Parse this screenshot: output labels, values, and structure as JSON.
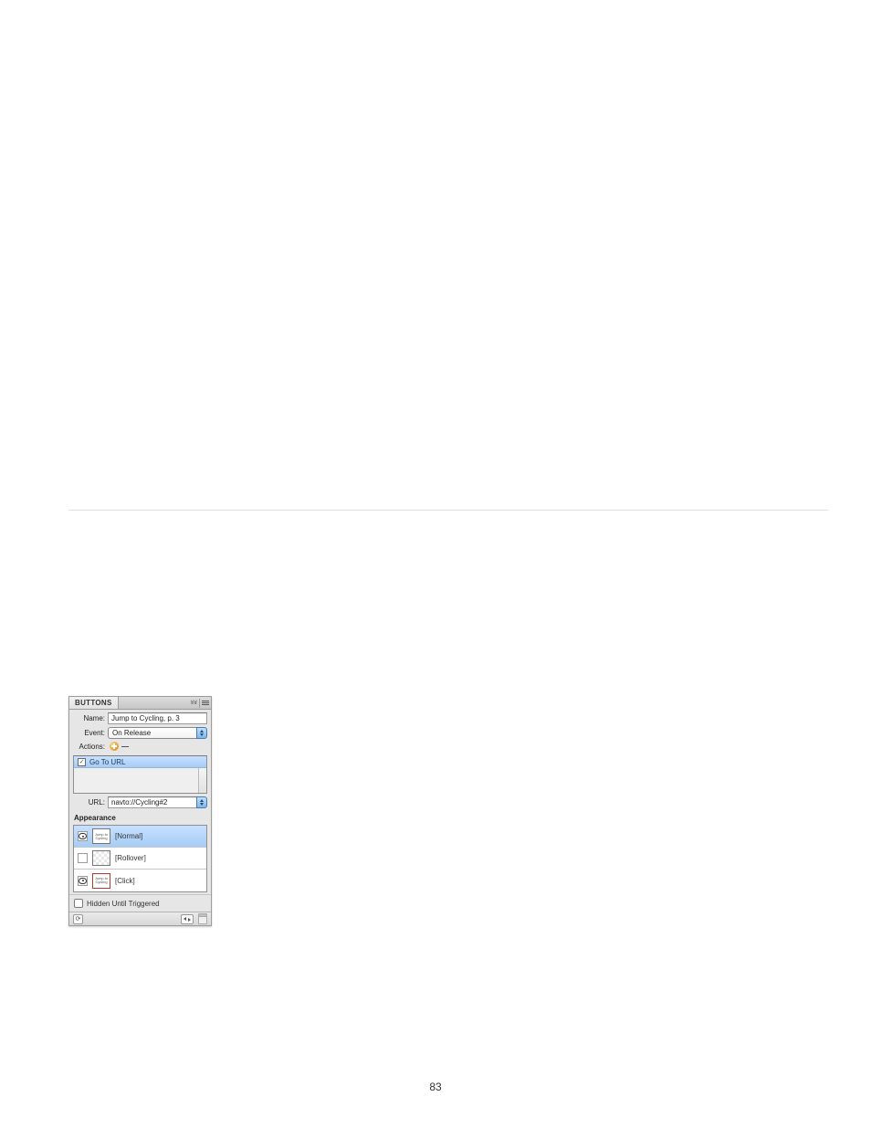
{
  "page_number": "83",
  "panel": {
    "tab_title": "BUTTONS",
    "header_right_label": "४४",
    "labels": {
      "name": "Name:",
      "event": "Event:",
      "actions": "Actions:",
      "url": "URL:"
    },
    "name_value": "Jump to Cycling, p. 3",
    "event_value": "On Release",
    "action_item": "Go To URL",
    "url_value": "navto://Cycling#2",
    "appearance_label": "Appearance",
    "states": [
      {
        "enabled": true,
        "label": "[Normal]",
        "thumb_text": "Jump to Cycling",
        "selected": true,
        "thumb_style": "plain"
      },
      {
        "enabled": false,
        "label": "[Rollover]",
        "thumb_text": "",
        "selected": false,
        "thumb_style": "patterned"
      },
      {
        "enabled": true,
        "label": "[Click]",
        "thumb_text": "Jump to Cycling",
        "selected": false,
        "thumb_style": "red"
      }
    ],
    "hidden_label": "Hidden Until Triggered"
  }
}
